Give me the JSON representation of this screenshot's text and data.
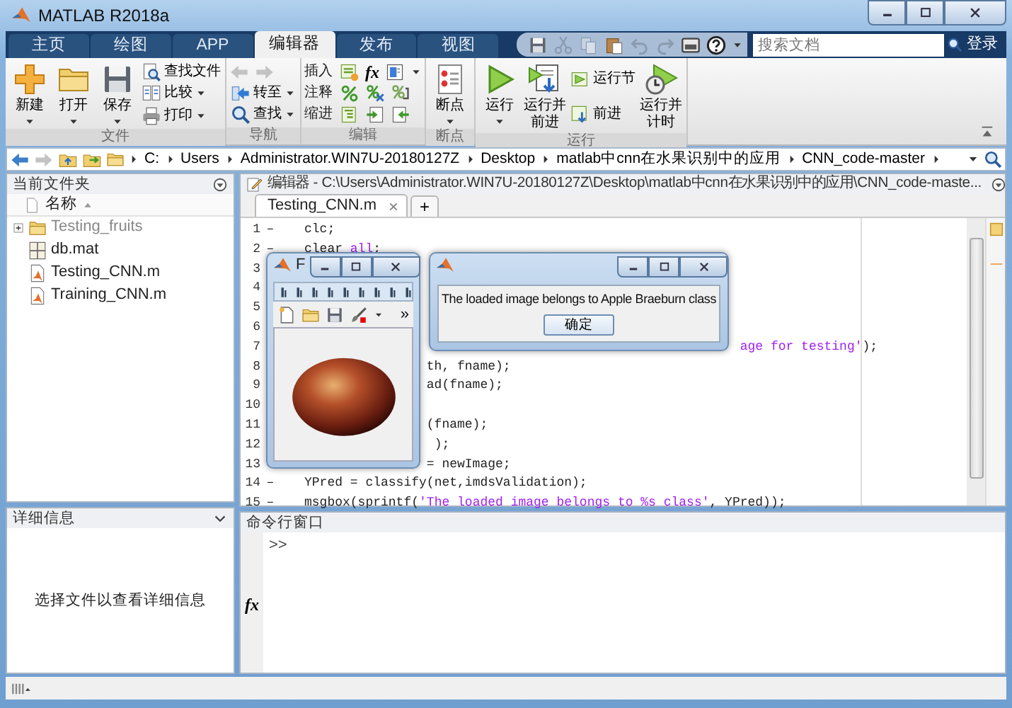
{
  "window": {
    "title": "MATLAB R2018a"
  },
  "tabs": [
    {
      "label": "主页",
      "selected": false
    },
    {
      "label": "绘图",
      "selected": false
    },
    {
      "label": "APP",
      "selected": false
    },
    {
      "label": "编辑器",
      "selected": true
    },
    {
      "label": "发布",
      "selected": false
    },
    {
      "label": "视图",
      "selected": false
    }
  ],
  "search": {
    "placeholder": "搜索文档"
  },
  "login": "登录",
  "ribbon": [
    {
      "label": "文件",
      "buttons": [
        {
          "label": "新建",
          "kind": "large",
          "dropdown": true
        },
        {
          "label": "打开",
          "kind": "large",
          "dropdown": true
        },
        {
          "label": "保存",
          "kind": "large",
          "dropdown": true
        },
        {
          "label": "查找文件",
          "kind": "small",
          "dropdown": false
        },
        {
          "label": "比较",
          "kind": "small",
          "dropdown": true
        },
        {
          "label": "打印",
          "kind": "small",
          "dropdown": true
        }
      ]
    },
    {
      "label": "导航",
      "buttons": [
        {
          "kind": "arrows",
          "disabled": true
        },
        {
          "label": "转至",
          "kind": "small",
          "dropdown": true
        },
        {
          "label": "查找",
          "kind": "small",
          "dropdown": true
        }
      ]
    },
    {
      "label": "编辑",
      "buttons": [
        {
          "label": "插入",
          "kind": "row",
          "function_label": "fx",
          "dropdown": true
        },
        {
          "label": "注释",
          "kind": "row",
          "dropdown": false
        },
        {
          "label": "缩进",
          "kind": "row",
          "dropdown": false
        }
      ]
    },
    {
      "label": "断点",
      "buttons": [
        {
          "label": "断点",
          "kind": "large",
          "dropdown": true
        }
      ]
    },
    {
      "label": "运行",
      "buttons": [
        {
          "label": "运行",
          "kind": "large",
          "dropdown": true
        },
        {
          "label": "运行并前进",
          "kind": "large",
          "dropdown": false
        },
        {
          "label": "运行节",
          "kind": "small",
          "dropdown": false
        },
        {
          "label": "前进",
          "kind": "small",
          "dropdown": false
        },
        {
          "label": "运行并计时",
          "kind": "large",
          "dropdown": false
        }
      ]
    }
  ],
  "address": [
    "C:",
    "Users",
    "Administrator.WIN7U-20180127Z",
    "Desktop",
    "matlab中cnn在水果识别中的应用",
    "CNN_code-master"
  ],
  "current_folder": {
    "title": "当前文件夹",
    "column": "名称",
    "files": [
      {
        "name": "Testing_fruits",
        "kind": "folder"
      },
      {
        "name": "db.mat",
        "kind": "mat"
      },
      {
        "name": "Testing_CNN.m",
        "kind": "script"
      },
      {
        "name": "Training_CNN.m",
        "kind": "script"
      }
    ]
  },
  "details": {
    "title": "详细信息",
    "message": "选择文件以查看详细信息"
  },
  "editor": {
    "title": "编辑器 - C:\\Users\\Administrator.WIN7U-20180127Z\\Desktop\\matlab中cnn在水果识别中的应用\\CNN_code-maste...",
    "tabs": [
      {
        "label": "Testing_CNN.m",
        "selected": true
      }
    ],
    "new_tab": "+",
    "lines": [
      {
        "number": "1",
        "marker": "–",
        "segments": [
          {
            "text": "clc;",
            "kind": "plain"
          }
        ]
      },
      {
        "number": "2",
        "marker": "–",
        "segments": [
          {
            "text": "clear ",
            "kind": "plain"
          },
          {
            "text": "all",
            "kind": "flagged"
          },
          {
            "text": ";",
            "kind": "plain"
          }
        ]
      },
      {
        "number": "3"
      },
      {
        "number": "4"
      },
      {
        "number": "5"
      },
      {
        "number": "6"
      },
      {
        "number": "7",
        "segments": [
          {
            "text": "                                                         age for testing'",
            "kind": "string"
          },
          {
            "text": ");",
            "kind": "plain"
          }
        ]
      },
      {
        "number": "8",
        "segments": [
          {
            "text": "                th, fname);",
            "kind": "plain"
          }
        ]
      },
      {
        "number": "9",
        "segments": [
          {
            "text": "                ad(fname);",
            "kind": "plain"
          }
        ]
      },
      {
        "number": "10"
      },
      {
        "number": "11",
        "segments": [
          {
            "text": "                (fname);",
            "kind": "plain"
          }
        ]
      },
      {
        "number": "12",
        "segments": [
          {
            "text": "                 );",
            "kind": "plain"
          }
        ]
      },
      {
        "number": "13",
        "segments": [
          {
            "text": "                = newImage;",
            "kind": "plain"
          }
        ]
      },
      {
        "number": "14",
        "marker": "–",
        "segments": [
          {
            "text": "YPred = classify(net,imdsValidation);",
            "kind": "plain"
          }
        ]
      },
      {
        "number": "15",
        "marker": "–",
        "segments": [
          {
            "text": "msgbox(sprintf(",
            "kind": "plain"
          },
          {
            "text": "'The loaded image belongs to %s class'",
            "kind": "string"
          },
          {
            "text": ", YPred));",
            "kind": "plain"
          }
        ]
      }
    ]
  },
  "command_window": {
    "title": "命令行窗口",
    "function_label": "fx",
    "prompt": ">>"
  },
  "figure_window": {
    "title": "F",
    "more": "»"
  },
  "dialog": {
    "message": "The loaded image belongs to Apple Braeburn class",
    "button": "确定"
  }
}
